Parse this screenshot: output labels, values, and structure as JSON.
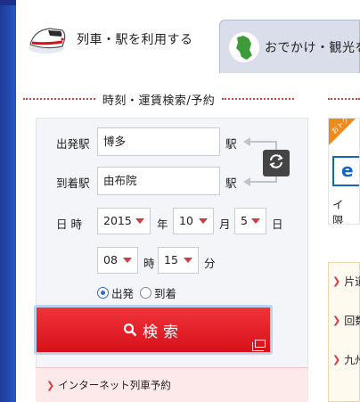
{
  "tabs": [
    {
      "label": "列車・駅を利用する",
      "icon": "train-icon",
      "active": true
    },
    {
      "label": "おでかけ・観光を",
      "icon": "kyushu-map-icon",
      "active": false
    }
  ],
  "section": {
    "title": "時刻・運賃検索/予約"
  },
  "form": {
    "departure": {
      "label": "出発駅",
      "value": "博多",
      "suffix": "駅"
    },
    "arrival": {
      "label": "到着駅",
      "value": "由布院",
      "suffix": "駅"
    },
    "date": {
      "label": "日 時",
      "year": "2015",
      "year_unit": "年",
      "month": "10",
      "month_unit": "月",
      "day": "5",
      "day_unit": "日"
    },
    "time": {
      "hour": "08",
      "hour_unit": "時",
      "minute": "15",
      "minute_unit": "分"
    },
    "mode_options": [
      {
        "label": "出発",
        "selected": true
      },
      {
        "label": "到着",
        "selected": false
      }
    ],
    "search_label": "検索"
  },
  "net_link": "インターネット列車予約",
  "promo": {
    "badge": "おトク",
    "logo": "e",
    "text1": "イ",
    "text2": "限"
  },
  "menu": [
    "片道",
    "回数",
    "九州"
  ],
  "colors": {
    "accent_red": "#d7101a",
    "link_red": "#d23c3c",
    "radio_blue": "#2b6bd6",
    "promo_orange": "#f08a1c"
  }
}
